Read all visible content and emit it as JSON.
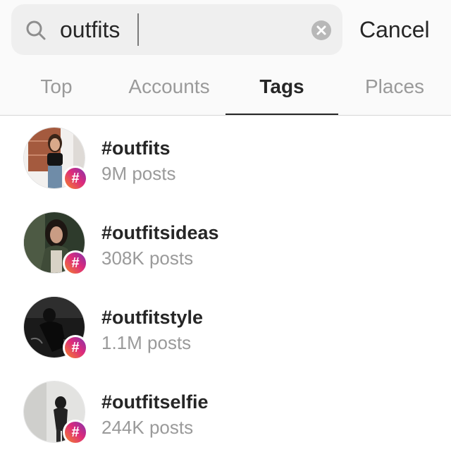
{
  "search": {
    "query": "outfits",
    "cancel_label": "Cancel"
  },
  "tabs": [
    {
      "label": "Top",
      "active": false
    },
    {
      "label": "Accounts",
      "active": false
    },
    {
      "label": "Tags",
      "active": true
    },
    {
      "label": "Places",
      "active": false
    }
  ],
  "results": [
    {
      "tag": "#outfits",
      "count": "9M posts"
    },
    {
      "tag": "#outfitsideas",
      "count": "308K posts"
    },
    {
      "tag": "#outfitstyle",
      "count": "1.1M posts"
    },
    {
      "tag": "#outfitselfie",
      "count": "244K posts"
    }
  ],
  "badge_symbol": "#",
  "icons": {
    "search": "search-icon",
    "clear": "clear-icon",
    "hashtag": "hashtag-badge-icon"
  },
  "colors": {
    "text_primary": "#262626",
    "text_secondary": "#9a9a9a",
    "search_bg": "#efefef",
    "badge_gradient": [
      "#f58529",
      "#dd2a7b",
      "#8134af"
    ]
  }
}
